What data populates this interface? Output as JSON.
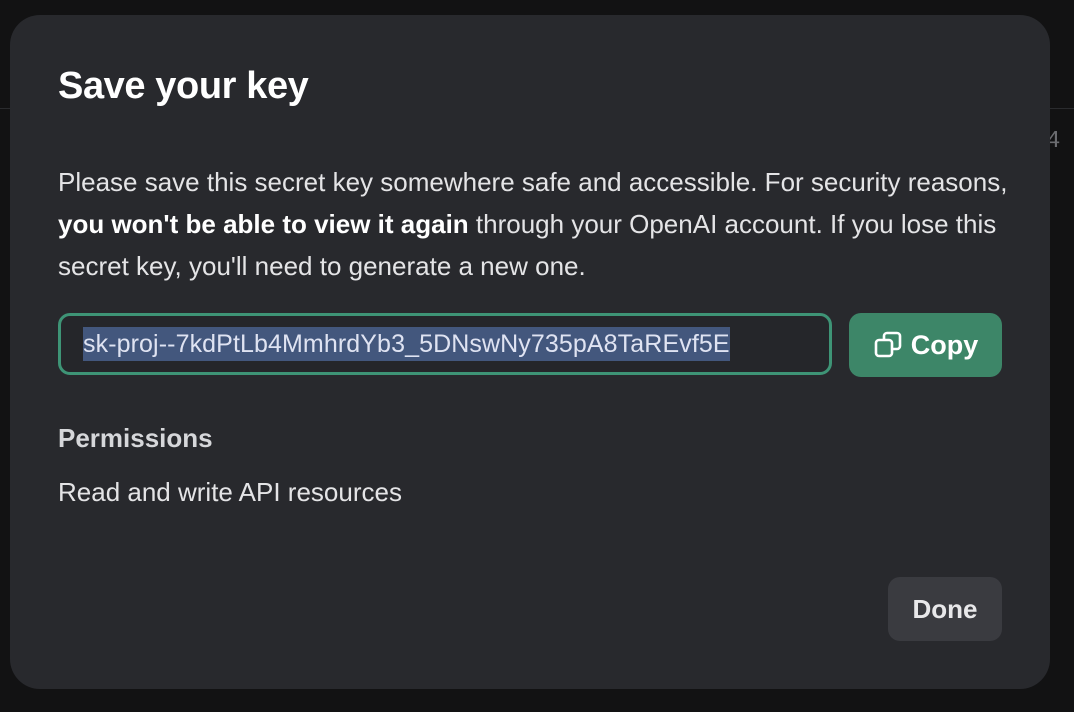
{
  "background": {
    "partial_text": "4"
  },
  "modal": {
    "title": "Save your key",
    "description": {
      "part1": "Please save this secret key somewhere safe and accessible. For security reasons, ",
      "emphasis": "you won't be able to view it again",
      "part2": " through your OpenAI account. If you lose this secret key, you'll need to generate a new one."
    },
    "key_value": "sk-proj--7kdPtLb4MmhrdYb3_5DNswNy735pA8TaREvf5E",
    "copy_label": "Copy",
    "copy_icon": "copy-icon",
    "permissions_heading": "Permissions",
    "permissions_value": "Read and write API resources",
    "done_label": "Done"
  },
  "colors": {
    "modal_bg": "#28292d",
    "accent": "#3d8668",
    "input_border": "#3e9476",
    "selection": "#43577d"
  }
}
